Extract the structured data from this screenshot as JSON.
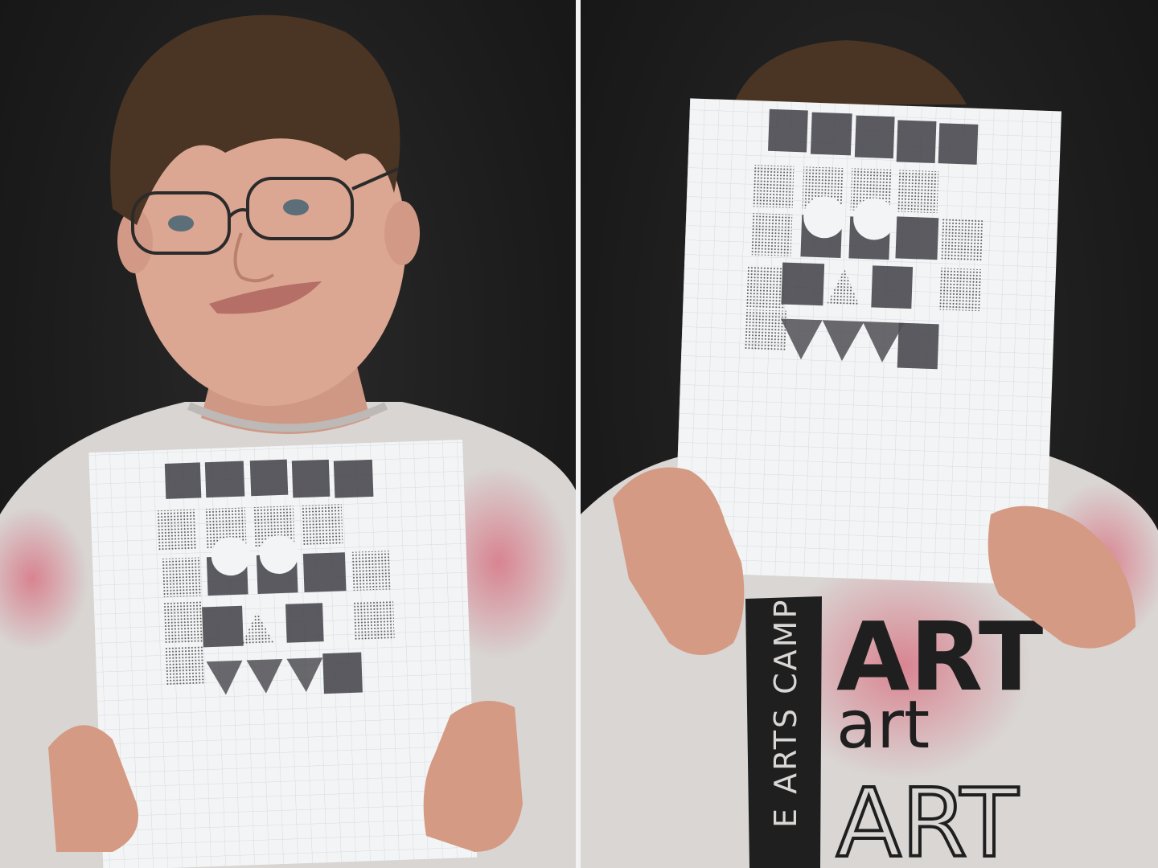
{
  "photo": {
    "layout": "diptych",
    "panels": [
      {
        "subject": "person holding stamped print",
        "pose": "smiling, print held at chest"
      },
      {
        "subject": "person holding stamped print",
        "pose": "print held up covering face"
      }
    ]
  },
  "shirt": {
    "vertical_text": "E ARTS CAMP",
    "line1": "ART",
    "line2": "art",
    "line3": "ART"
  },
  "colors": {
    "background": "#1c1c1c",
    "shirt": "#d9d6d4",
    "paper": "#f4f5f6",
    "ink": "#3a3a40",
    "skin": "#d9a48e",
    "hair": "#4a3424",
    "speckle": "#d9415a"
  }
}
